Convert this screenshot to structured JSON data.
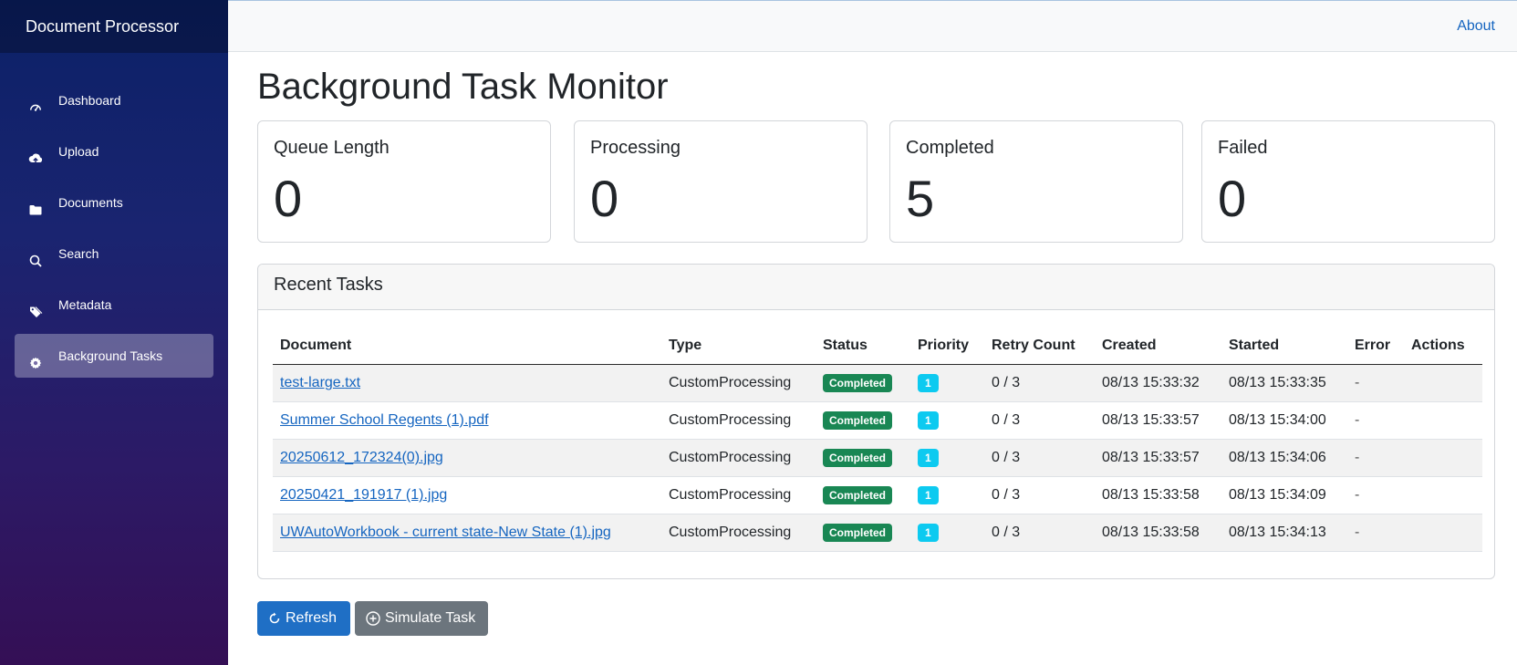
{
  "brand": "Document Processor",
  "sidebar": {
    "items": [
      {
        "label": "Dashboard",
        "icon": "speedometer-icon"
      },
      {
        "label": "Upload",
        "icon": "cloud-upload-icon"
      },
      {
        "label": "Documents",
        "icon": "folder-icon"
      },
      {
        "label": "Search",
        "icon": "search-icon"
      },
      {
        "label": "Metadata",
        "icon": "tags-icon"
      },
      {
        "label": "Background Tasks",
        "icon": "gear-icon",
        "active": true
      }
    ]
  },
  "topbar": {
    "about": "About"
  },
  "page": {
    "title": "Background Task Monitor"
  },
  "stats": [
    {
      "label": "Queue Length",
      "value": "0"
    },
    {
      "label": "Processing",
      "value": "0"
    },
    {
      "label": "Completed",
      "value": "5"
    },
    {
      "label": "Failed",
      "value": "0"
    }
  ],
  "recent": {
    "title": "Recent Tasks",
    "columns": [
      "Document",
      "Type",
      "Status",
      "Priority",
      "Retry Count",
      "Created",
      "Started",
      "Error",
      "Actions"
    ],
    "rows": [
      {
        "document": "test-large.txt",
        "type": "CustomProcessing",
        "status": "Completed",
        "priority": "1",
        "retry": "0 / 3",
        "created": "08/13 15:33:32",
        "started": "08/13 15:33:35",
        "error": "-",
        "actions": ""
      },
      {
        "document": "Summer School Regents (1).pdf",
        "type": "CustomProcessing",
        "status": "Completed",
        "priority": "1",
        "retry": "0 / 3",
        "created": "08/13 15:33:57",
        "started": "08/13 15:34:00",
        "error": "-",
        "actions": ""
      },
      {
        "document": "20250612_172324(0).jpg",
        "type": "CustomProcessing",
        "status": "Completed",
        "priority": "1",
        "retry": "0 / 3",
        "created": "08/13 15:33:57",
        "started": "08/13 15:34:06",
        "error": "-",
        "actions": ""
      },
      {
        "document": "20250421_191917 (1).jpg",
        "type": "CustomProcessing",
        "status": "Completed",
        "priority": "1",
        "retry": "0 / 3",
        "created": "08/13 15:33:58",
        "started": "08/13 15:34:09",
        "error": "-",
        "actions": ""
      },
      {
        "document": "UWAutoWorkbook - current state-New State (1).jpg",
        "type": "CustomProcessing",
        "status": "Completed",
        "priority": "1",
        "retry": "0 / 3",
        "created": "08/13 15:33:58",
        "started": "08/13 15:34:13",
        "error": "-",
        "actions": ""
      }
    ]
  },
  "buttons": {
    "refresh": "Refresh",
    "simulate": "Simulate Task"
  },
  "colors": {
    "primary": "#1f6fc5",
    "secondary": "#6c757d",
    "success": "#198754",
    "info": "#0dcaf0",
    "link": "#1565c0"
  }
}
